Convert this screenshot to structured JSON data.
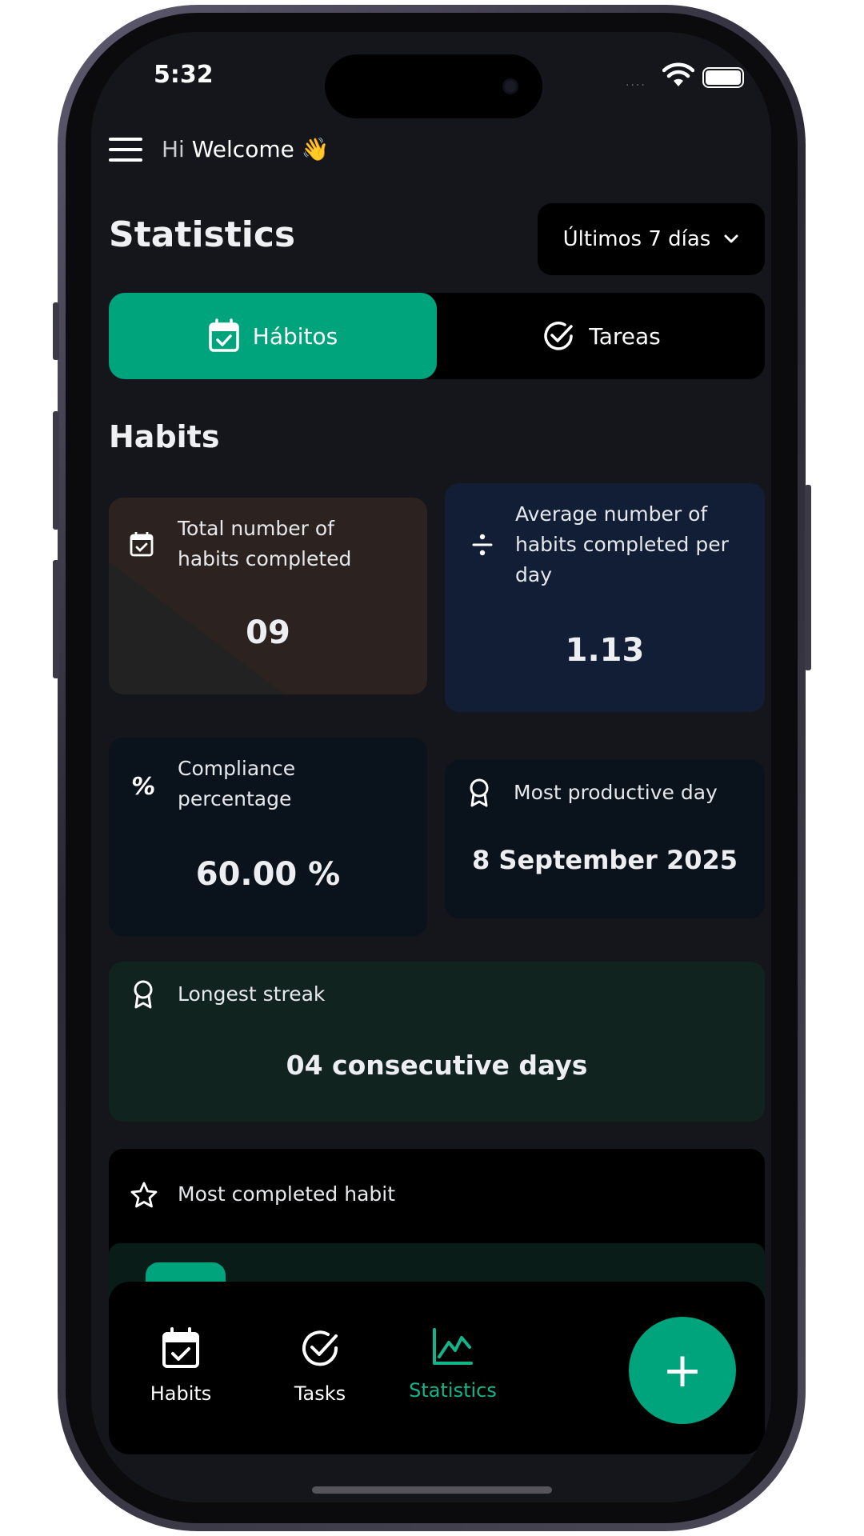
{
  "status_bar": {
    "time": "5:32",
    "signal": "....",
    "wifi_icon": "wifi-icon",
    "battery_icon": "battery-icon"
  },
  "header": {
    "menu_icon": "menu-icon",
    "greeting_hi": "Hi",
    "greeting_name": "Welcome",
    "greeting_emoji": "👋"
  },
  "page": {
    "title": "Statistics",
    "period_value": "Últimos 7 días",
    "period_icon": "chevron-down-icon"
  },
  "tabs": [
    {
      "label": "Hábitos",
      "icon": "calendar-check-icon",
      "active": true
    },
    {
      "label": "Tareas",
      "icon": "check-circle-icon",
      "active": false
    }
  ],
  "section": {
    "title": "Habits"
  },
  "stats": {
    "total": {
      "label_1": "Total number of",
      "label_2": "habits completed",
      "value": "09",
      "icon": "calendar-check-icon"
    },
    "average": {
      "label_1": "Average number of",
      "label_2": "habits completed per",
      "label_3": "day",
      "value": "1.13",
      "icon": "divide-icon"
    },
    "compliance": {
      "label_1": "Compliance",
      "label_2": "percentage",
      "value": "60.00 %",
      "icon": "percent-icon"
    },
    "productive_day": {
      "label": "Most productive day",
      "value": "8 September 2025",
      "icon": "award-icon"
    },
    "streak": {
      "label": "Longest streak",
      "value": "04 consecutive days",
      "icon": "award-icon"
    },
    "most_completed": {
      "label": "Most completed habit",
      "icon": "star-icon"
    }
  },
  "bottom_nav": {
    "items": [
      {
        "label": "Habits",
        "icon": "calendar-check-icon",
        "active": false
      },
      {
        "label": "Tasks",
        "icon": "check-circle-icon",
        "active": false
      },
      {
        "label": "Statistics",
        "icon": "chart-line-icon",
        "active": true
      }
    ],
    "fab_symbol": "+",
    "fab_icon": "plus-icon"
  },
  "colors": {
    "accent": "#00a47c",
    "accent_text": "#12b58a",
    "background": "#14161b",
    "card_black": "#000000"
  }
}
